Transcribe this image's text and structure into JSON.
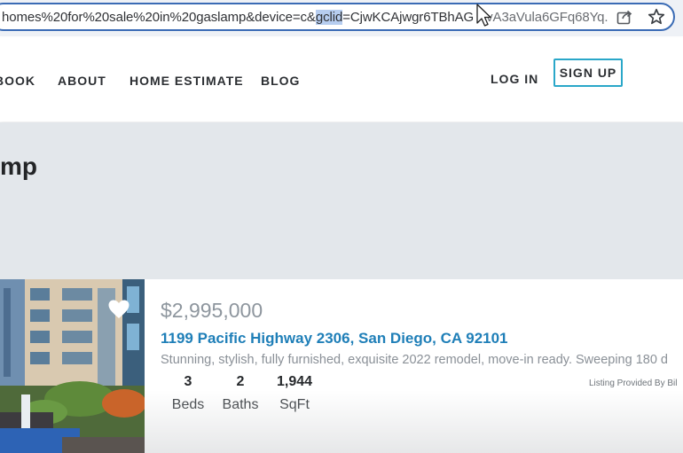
{
  "browser": {
    "url_before": "homes%20for%20sale%20in%20gaslamp&device=c&",
    "url_highlight": "gclid",
    "url_after": "=CjwKCAjwgr6TBhAG",
    "url_tail": "vA3aVula6GFq68Yq."
  },
  "nav": {
    "items": [
      {
        "label": "BOOK"
      },
      {
        "label": "ABOUT"
      },
      {
        "label": "HOME ESTIMATE"
      },
      {
        "label": "BLOG"
      }
    ],
    "login_label": "LOG IN",
    "signup_label": "SIGN UP"
  },
  "hero": {
    "title": "mp"
  },
  "listing": {
    "price": "$2,995,000",
    "address": "1199 Pacific Highway 2306, San Diego, CA 92101",
    "description": "Stunning, stylish, fully furnished, exquisite 2022 remodel, move-in ready. Sweeping 180 d",
    "provided_by": "Listing Provided By Bil",
    "beds": {
      "value": "3",
      "label": "Beds"
    },
    "baths": {
      "value": "2",
      "label": "Baths"
    },
    "sqft": {
      "value": "1,944",
      "label": "SqFt"
    }
  },
  "colors": {
    "accent": "#2aa7c9",
    "address_link": "#1f7fb8",
    "hero_bg": "#e3e7eb",
    "url_border": "#3a6bb5"
  }
}
